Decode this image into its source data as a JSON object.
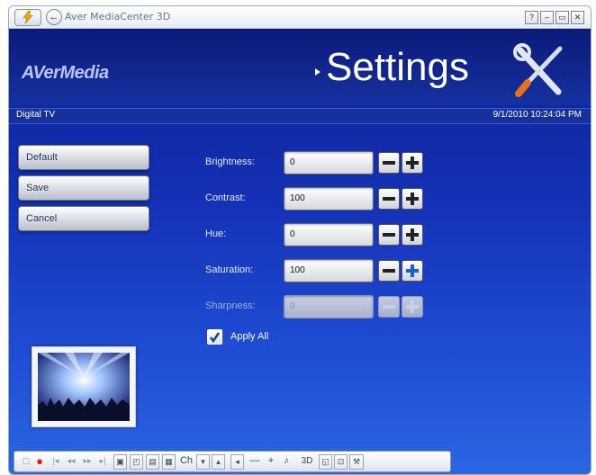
{
  "window": {
    "title": "Aver MediaCenter 3D",
    "controls": [
      "?",
      "–",
      "▭",
      "✕"
    ]
  },
  "header": {
    "logo": "AVerMedia",
    "title": "Settings"
  },
  "infobar": {
    "source": "Digital TV",
    "datetime": "9/1/2010 10:24:04 PM"
  },
  "side_buttons": [
    {
      "label": "Default"
    },
    {
      "label": "Save"
    },
    {
      "label": "Cancel"
    }
  ],
  "settings": [
    {
      "label": "Brightness:",
      "value": "0",
      "enabled": true
    },
    {
      "label": "Contrast:",
      "value": "100",
      "enabled": true
    },
    {
      "label": "Hue:",
      "value": "0",
      "enabled": true
    },
    {
      "label": "Saturation:",
      "value": "100",
      "enabled": true
    },
    {
      "label": "Sharpness:",
      "value": "0",
      "enabled": false
    }
  ],
  "apply_all": {
    "label": "Apply All",
    "checked": true
  },
  "toolbar": {
    "channel_label": "Ch",
    "mode_label": "3D"
  }
}
